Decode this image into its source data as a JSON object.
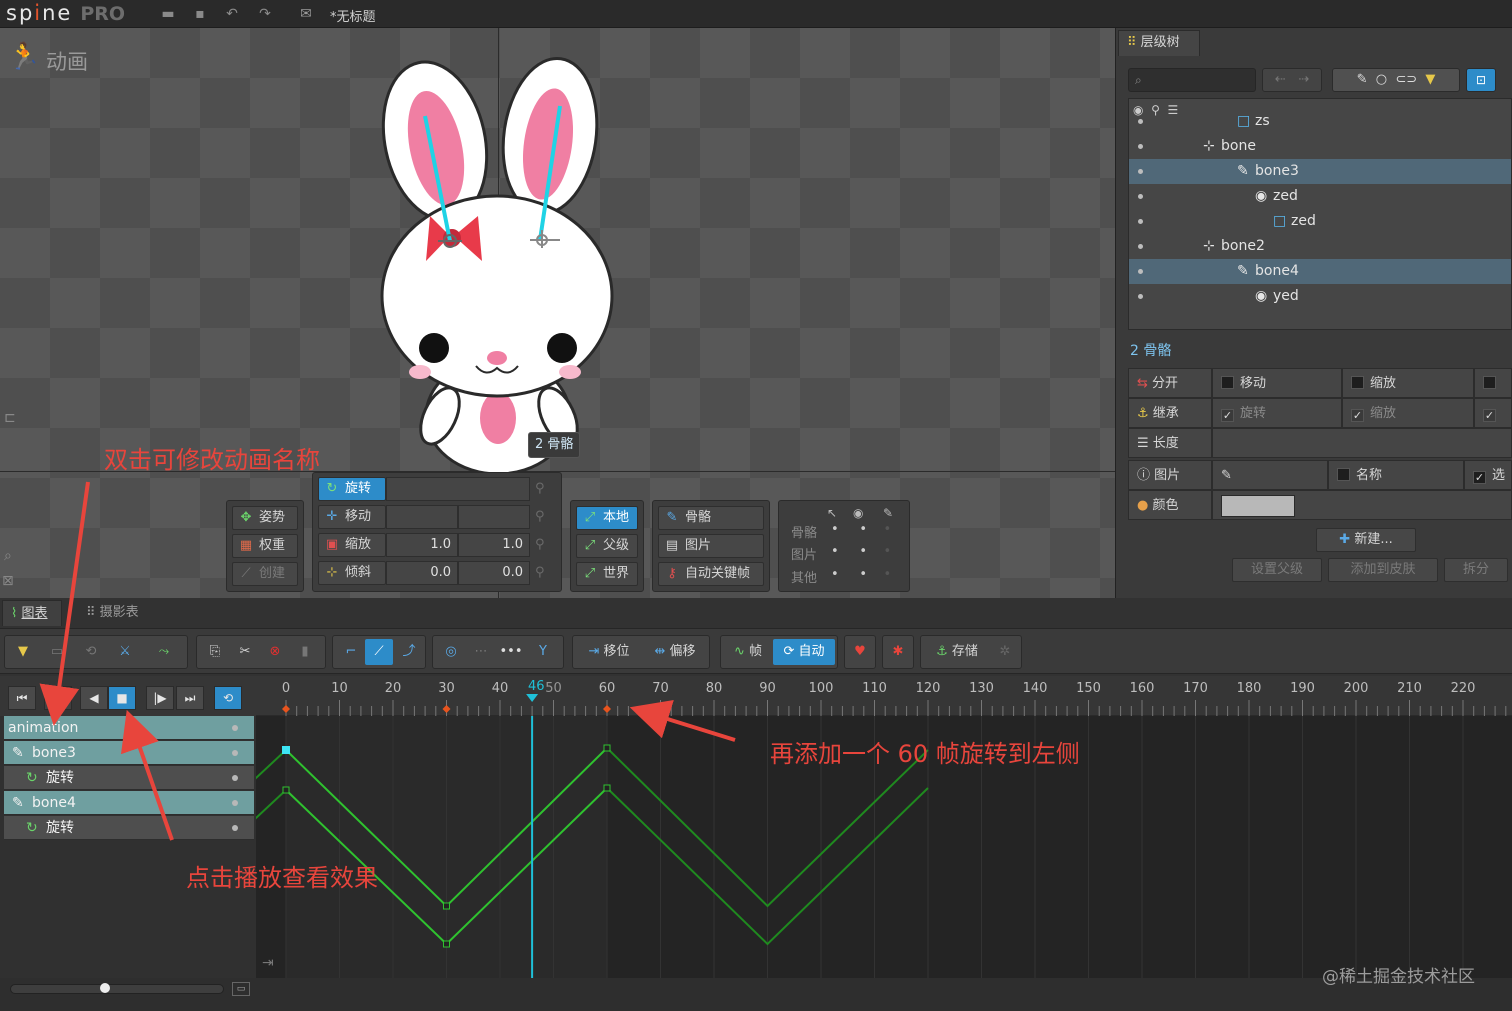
{
  "app": {
    "logo_left": "sp",
    "logo_i": "i",
    "logo_right": "ne",
    "logo_pro": "PRO",
    "doc_title": "*无标题"
  },
  "menubar_icons": [
    "folder-icon",
    "save-icon",
    "undo-icon",
    "redo-icon",
    "export-icon"
  ],
  "viewport": {
    "title": "动画",
    "bone_label": "2 骨骼"
  },
  "tools": {
    "pose": "姿势",
    "weights": "权重",
    "create": "创建",
    "rotate": "旋转",
    "translate": "移动",
    "scale": "缩放",
    "shear": "倾斜",
    "scale_x": "1.0",
    "scale_y": "1.0",
    "shear_x": "0.0",
    "shear_y": "0.0",
    "local": "本地",
    "parent": "父级",
    "world": "世界",
    "bones": "骨骼",
    "images": "图片",
    "autokey": "自动关键帧",
    "vis_bones": "骨骼",
    "vis_images": "图片",
    "vis_others": "其他"
  },
  "tree": {
    "tab": "层级树",
    "search_placeholder": "",
    "rows": [
      {
        "label": "zs",
        "selected": false
      },
      {
        "label": "bone",
        "selected": false
      },
      {
        "label": "bone3",
        "selected": true
      },
      {
        "label": "zed",
        "selected": false
      },
      {
        "label": "zed",
        "selected": false
      },
      {
        "label": "bone2",
        "selected": false
      },
      {
        "label": "bone4",
        "selected": true
      },
      {
        "label": "yed",
        "selected": false
      }
    ]
  },
  "properties": {
    "header": "2 骨骼",
    "split": "分开",
    "translate": "移动",
    "scale": "缩放",
    "inherit": "继承",
    "rotation": "旋转",
    "inherit_scale": "缩放",
    "length": "长度",
    "image": "图片",
    "name": "名称",
    "select": "选",
    "color": "颜色",
    "color_value": "#b8b8b8",
    "new_button": "新建...",
    "set_parent": "设置父级",
    "add_to_skin": "添加到皮肤",
    "split_button": "拆分"
  },
  "bottom_tabs": {
    "graph": "图表",
    "dopesheet": "摄影表"
  },
  "timeline_toolbar": {
    "offset": "移位",
    "shift": "偏移",
    "frames": "帧",
    "auto": "自动",
    "store": "存储"
  },
  "timeline": {
    "current_frame": "46",
    "ruler_labels": [
      "0",
      "10",
      "20",
      "30",
      "40",
      "50",
      "60",
      "70",
      "80",
      "90",
      "100",
      "110",
      "120",
      "130",
      "140",
      "150",
      "160",
      "170",
      "180",
      "190",
      "200",
      "210",
      "220"
    ],
    "keyframes": [
      0,
      30,
      60
    ],
    "tracks": [
      {
        "label": "animation",
        "level": 0
      },
      {
        "label": "bone3",
        "level": 1
      },
      {
        "label": "旋转",
        "level": 2
      },
      {
        "label": "bone4",
        "level": 1
      },
      {
        "label": "旋转",
        "level": 2
      }
    ]
  },
  "annotations": {
    "rename": "双击可修改动画名称",
    "play": "点击播放查看效果",
    "add_key": "再添加一个 60 帧旋转到左侧"
  },
  "watermark": "@稀土掘金技术社区",
  "colors": {
    "accent": "#2d8cc9",
    "curve": "#2fc22f",
    "playhead": "#1fc0d8",
    "annotation": "#e8453c",
    "keyframe": "#e8541e"
  }
}
